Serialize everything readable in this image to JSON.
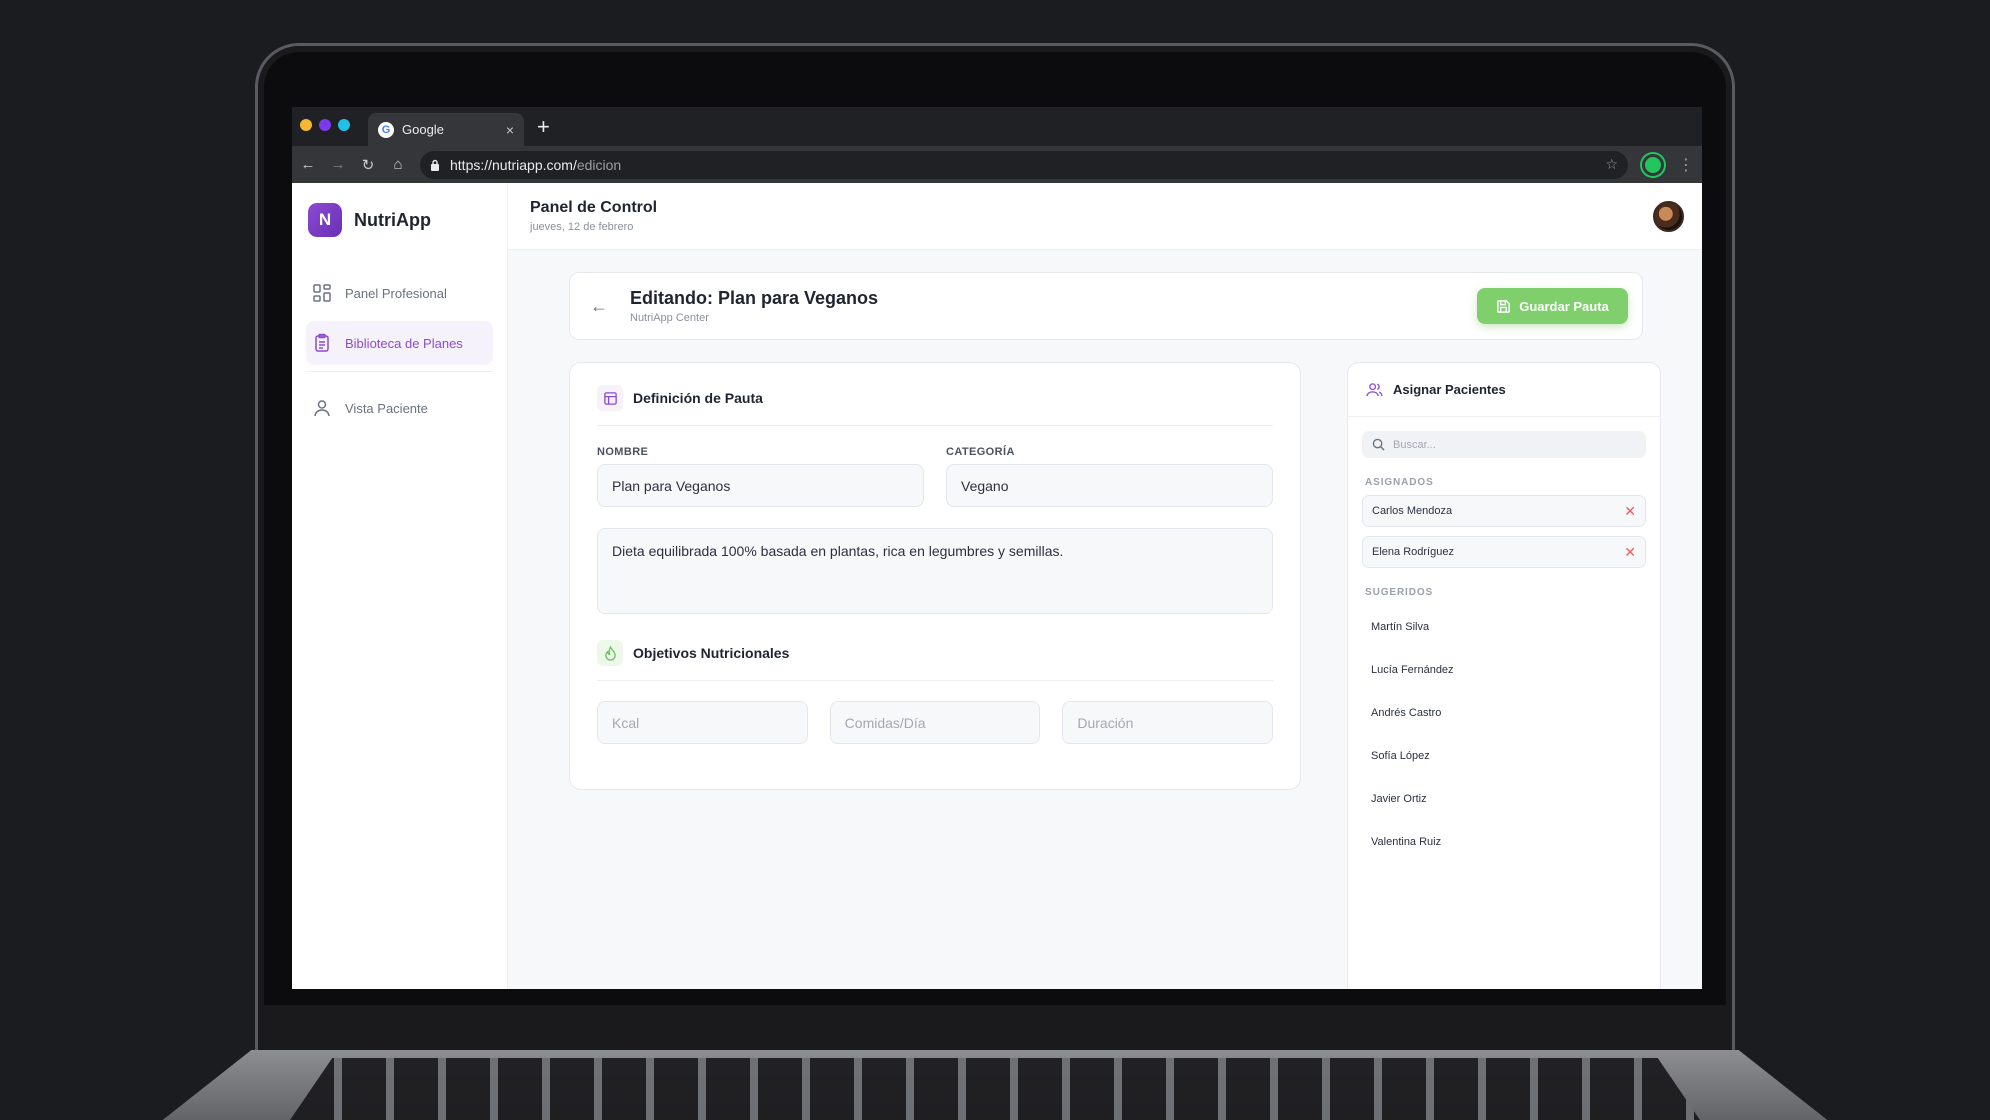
{
  "browser": {
    "tab_title": "Google",
    "tab_close": "×",
    "new_tab": "+",
    "url_base": "https://nutriapp.com/",
    "url_path": "edicion",
    "traffic_colors": [
      "#f5b731",
      "#7c3aed",
      "#22c1e6"
    ]
  },
  "sidebar": {
    "brand_letter": "N",
    "brand_name": "NutriApp",
    "items": [
      {
        "label": "Panel Profesional",
        "icon": "grid-icon",
        "active": false
      },
      {
        "label": "Biblioteca de Planes",
        "icon": "clipboard-icon",
        "active": true
      },
      {
        "label": "Vista Paciente",
        "icon": "user-icon",
        "active": false
      }
    ]
  },
  "topbar": {
    "title": "Panel de Control",
    "date": "jueves, 12 de febrero"
  },
  "editor": {
    "title": "Editando: Plan para Veganos",
    "subtitle": "NutriApp Center",
    "save_label": "Guardar Pauta"
  },
  "definition": {
    "title": "Definición de Pauta",
    "name_label": "NOMBRE",
    "name_value": "Plan para Veganos",
    "category_label": "CATEGORÍA",
    "category_value": "Vegano",
    "description": "Dieta equilibrada 100% basada en plantas, rica en legumbres y semillas.",
    "objectives_title": "Objetivos Nutricionales",
    "kcal_placeholder": "Kcal",
    "meals_placeholder": "Comidas/Día",
    "duration_placeholder": "Duración"
  },
  "assign": {
    "title": "Asignar Pacientes",
    "search_placeholder": "Buscar...",
    "assigned_label": "ASIGNADOS",
    "assigned": [
      "Carlos Mendoza",
      "Elena Rodríguez"
    ],
    "suggested_label": "SUGERIDOS",
    "suggested": [
      "Martín Silva",
      "Lucía Fernández",
      "Andrés Castro",
      "Sofía López",
      "Javier Ortiz",
      "Valentina Ruiz"
    ]
  },
  "colors": {
    "brand": "#8b4bd1",
    "save_button": "#7fcf6d",
    "remove": "#ef5a5a"
  }
}
